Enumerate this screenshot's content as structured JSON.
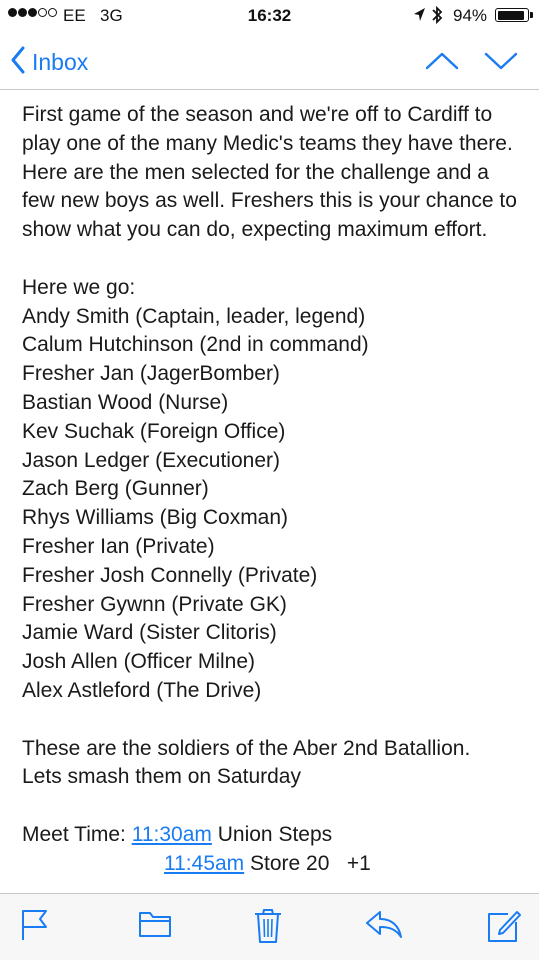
{
  "status_bar": {
    "carrier": "EE",
    "network": "3G",
    "time": "16:32",
    "battery": "94%",
    "battery_level": 0.94
  },
  "nav": {
    "back_label": "Inbox"
  },
  "message": {
    "intro": "First game of the season and we're off to Cardiff to play one of the many Medic's teams they have there. Here are the men selected for the challenge and a few new boys as well. Freshers this is your chance to show what you can do, expecting maximum effort.",
    "roster_heading": "Here we go:",
    "roster": [
      "Andy Smith (Captain, leader, legend)",
      "Calum Hutchinson (2nd in command)",
      "Fresher Jan (JagerBomber)",
      "Bastian Wood (Nurse)",
      "Kev Suchak (Foreign Office)",
      "Jason Ledger (Executioner)",
      "Zach Berg (Gunner)",
      "Rhys Williams (Big Coxman)",
      "Fresher Ian (Private)",
      "Fresher Josh Connelly (Private)",
      "Fresher Gywnn (Private GK)",
      "Jamie Ward (Sister Clitoris)",
      "Josh Allen (Officer Milne)",
      "Alex Astleford (The Drive)"
    ],
    "closing_1": "These are the soldiers of the Aber 2nd Batallion.",
    "closing_2": "Lets smash them on Saturday",
    "meet_label": "Meet Time:",
    "meet_time_1": "11:30am",
    "meet_place_1": "Union Steps",
    "meet_time_2": "11:45am",
    "meet_place_2": "Store 20",
    "meet_extra_2": "+1"
  },
  "toolbar": {
    "icons": [
      "flag-icon",
      "folder-icon",
      "trash-icon",
      "reply-icon",
      "compose-icon"
    ]
  },
  "colors": {
    "accent": "#1a7cf2",
    "text": "#1a1a1a",
    "toolbar_bg": "#f7f7f8",
    "separator": "#c8c8cc"
  }
}
